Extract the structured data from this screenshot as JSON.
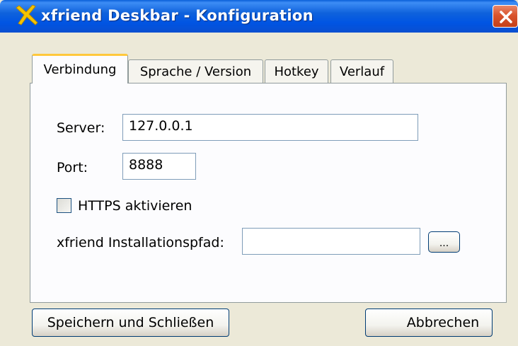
{
  "window": {
    "title": "xfriend Deskbar - Konfiguration",
    "close_label": "close"
  },
  "tabs": [
    {
      "label": "Verbindung",
      "active": true
    },
    {
      "label": "Sprache / Version",
      "active": false
    },
    {
      "label": "Hotkey",
      "active": false
    },
    {
      "label": "Verlauf",
      "active": false
    }
  ],
  "connection": {
    "server_label": "Server:",
    "server_value": "127.0.0.1",
    "port_label": "Port:",
    "port_value": "8888",
    "https_label": "HTTPS aktivieren",
    "https_checked": false,
    "path_label": "xfriend Installationspfad:",
    "path_value": "",
    "browse_label": "..."
  },
  "footer": {
    "save_label": "Speichern und Schließen",
    "cancel_label": "Abbrechen"
  },
  "colors": {
    "titlebar": "#0054e3",
    "active_tab_highlight": "#ffc83c",
    "close_button": "#d9542d"
  }
}
